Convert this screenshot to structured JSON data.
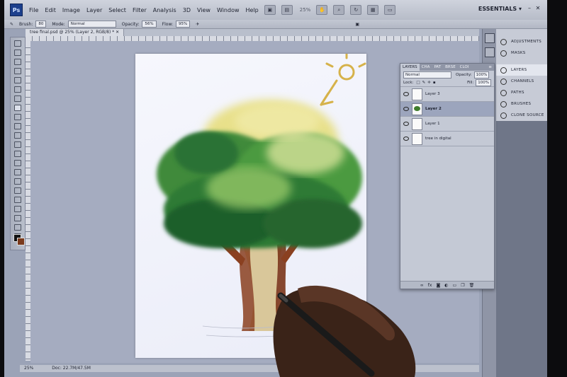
{
  "app": {
    "logo": "Ps",
    "workspace": "ESSENTIALS"
  },
  "menu": [
    "File",
    "Edit",
    "Image",
    "Layer",
    "Select",
    "Filter",
    "Analysis",
    "3D",
    "View",
    "Window",
    "Help"
  ],
  "menubar_zoom": "25%",
  "options": {
    "brush_label": "Brush:",
    "brush_size": "80",
    "mode_label": "Mode:",
    "mode_value": "Normal",
    "opacity_label": "Opacity:",
    "opacity_value": "56%",
    "flow_label": "Flow:",
    "flow_value": "95%"
  },
  "document_tab": "tree final.psd @ 25% (Layer 2, RGB/8) *",
  "status": {
    "zoom": "25%",
    "doc": "Doc: 22.7M/47.5M"
  },
  "dock": {
    "items": [
      {
        "label": "ADJUSTMENTS",
        "icon": "adjustments-icon"
      },
      {
        "label": "MASKS",
        "icon": "masks-icon"
      },
      {
        "label": "LAYERS",
        "icon": "layers-icon"
      },
      {
        "label": "CHANNELS",
        "icon": "channels-icon"
      },
      {
        "label": "PATHS",
        "icon": "paths-icon"
      },
      {
        "label": "BRUSHES",
        "icon": "brushes-icon"
      },
      {
        "label": "CLONE SOURCE",
        "icon": "clone-source-icon"
      }
    ],
    "active": "LAYERS"
  },
  "layers_panel": {
    "tabs": [
      "LAYERS",
      "CHA",
      "PAT",
      "BRSE",
      "CLOI"
    ],
    "blend_mode": "Normal",
    "opacity_label": "Opacity:",
    "opacity_value": "100%",
    "lock_label": "Lock:",
    "fill_label": "Fill:",
    "fill_value": "100%",
    "layers": [
      {
        "name": "Layer 3"
      },
      {
        "name": "Layer 2"
      },
      {
        "name": "Layer 1"
      },
      {
        "name": "tree in digital"
      }
    ],
    "active_layer": "Layer 2",
    "footer_icons": [
      "link-icon",
      "fx-icon",
      "mask-icon",
      "adjustment-icon",
      "group-icon",
      "new-layer-icon",
      "trash-icon"
    ]
  },
  "colors": {
    "foreground": "#111111",
    "background": "#7a3a1c",
    "sun": "#d6b24a"
  }
}
